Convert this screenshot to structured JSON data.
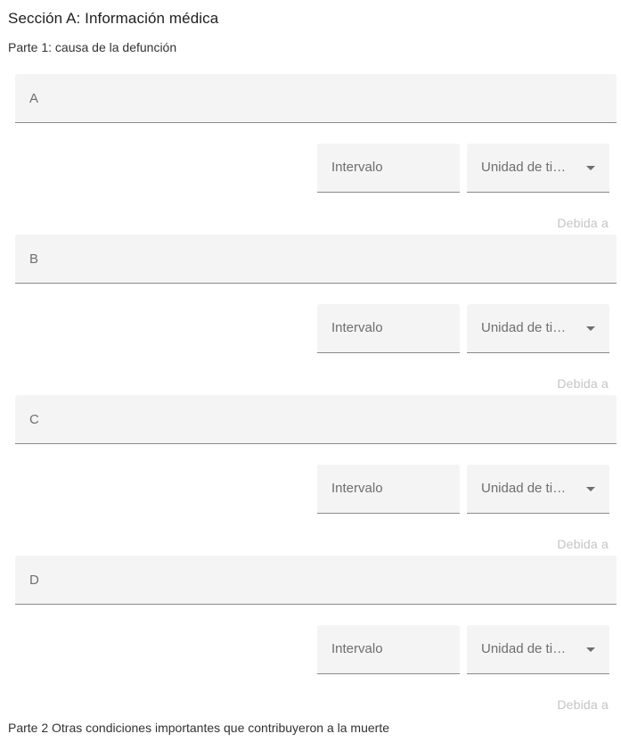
{
  "section": {
    "title": "Sección A: Información médica"
  },
  "part1": {
    "label": "Parte 1: causa de la defunción"
  },
  "rows": [
    {
      "cause_label": "A",
      "interval_label": "Intervalo",
      "unit_label": "Unidad de tiempo",
      "due_to_label": "Debida a"
    },
    {
      "cause_label": "B",
      "interval_label": "Intervalo",
      "unit_label": "Unidad de tiempo",
      "due_to_label": "Debida a"
    },
    {
      "cause_label": "C",
      "interval_label": "Intervalo",
      "unit_label": "Unidad de tiempo",
      "due_to_label": "Debida a"
    },
    {
      "cause_label": "D",
      "interval_label": "Intervalo",
      "unit_label": "Unidad de tiempo",
      "due_to_label": "Debida a"
    }
  ],
  "part2": {
    "label": "Parte 2 Otras condiciones importantes que contribuyeron a la muerte"
  },
  "icons": {
    "dropdown": "chevron-down-icon"
  }
}
